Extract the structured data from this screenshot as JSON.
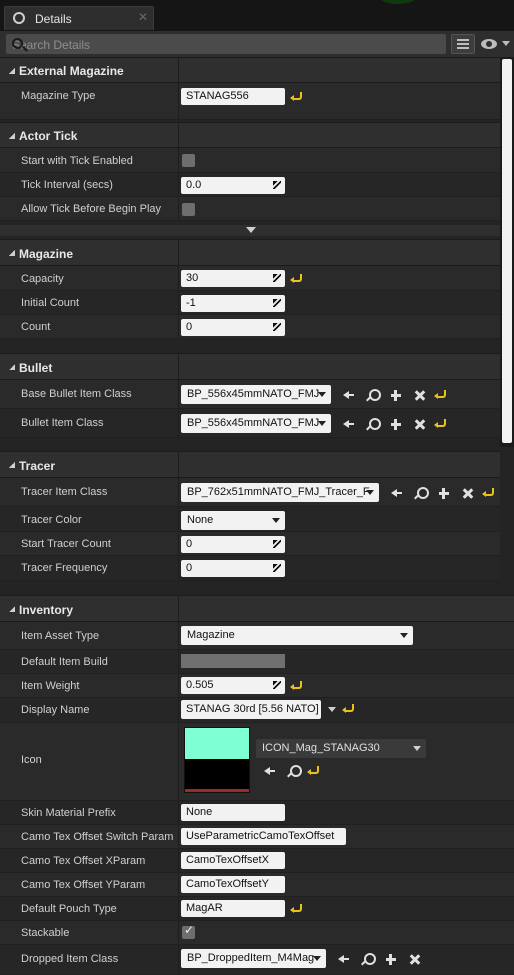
{
  "tab": {
    "label": "Details"
  },
  "search": {
    "placeholder": "Search Details"
  },
  "colors": {
    "reset_arrow": "#e9c21e",
    "icon_preview_top": "#7fffd4",
    "icon_preview_bottom": "#000000",
    "icon_preview_line": "#9c2a2a"
  },
  "categories": {
    "external_magazine": {
      "title": "External Magazine",
      "props": {
        "magazine_type": {
          "label": "Magazine Type",
          "value": "STANAG556"
        }
      }
    },
    "actor_tick": {
      "title": "Actor Tick",
      "props": {
        "start_with_tick": {
          "label": "Start with Tick Enabled",
          "checked": false
        },
        "tick_interval": {
          "label": "Tick Interval (secs)",
          "value": "0.0"
        },
        "allow_tick": {
          "label": "Allow Tick Before Begin Play",
          "checked": false
        }
      }
    },
    "magazine": {
      "title": "Magazine",
      "props": {
        "capacity": {
          "label": "Capacity",
          "value": "30"
        },
        "initial_count": {
          "label": "Initial Count",
          "value": "-1"
        },
        "count": {
          "label": "Count",
          "value": "0"
        }
      }
    },
    "bullet": {
      "title": "Bullet",
      "props": {
        "base_bullet_item_class": {
          "label": "Base Bullet Item Class",
          "value": "BP_556x45mmNATO_FMJ"
        },
        "bullet_item_class": {
          "label": "Bullet Item Class",
          "value": "BP_556x45mmNATO_FMJ"
        }
      }
    },
    "tracer": {
      "title": "Tracer",
      "props": {
        "tracer_item_class": {
          "label": "Tracer Item Class",
          "value": "BP_762x51mmNATO_FMJ_Tracer_F"
        },
        "tracer_color": {
          "label": "Tracer Color",
          "value": "None"
        },
        "start_tracer_count": {
          "label": "Start Tracer Count",
          "value": "0"
        },
        "tracer_frequency": {
          "label": "Tracer Frequency",
          "value": "0"
        }
      }
    },
    "inventory": {
      "title": "Inventory",
      "props": {
        "item_asset_type": {
          "label": "Item Asset Type",
          "value": "Magazine"
        },
        "default_item_build": {
          "label": "Default Item Build"
        },
        "item_weight": {
          "label": "Item Weight",
          "value": "0.505"
        },
        "display_name": {
          "label": "Display Name",
          "value": "STANAG 30rd [5.56 NATO]"
        },
        "icon": {
          "label": "Icon",
          "value": "ICON_Mag_STANAG30"
        },
        "skin_material_prefix": {
          "label": "Skin Material Prefix",
          "value": "None"
        },
        "camo_switch_param": {
          "label": "Camo Tex Offset Switch Param",
          "value": "UseParametricCamoTexOffset"
        },
        "camo_x_param": {
          "label": "Camo Tex Offset XParam",
          "value": "CamoTexOffsetX"
        },
        "camo_y_param": {
          "label": "Camo Tex Offset YParam",
          "value": "CamoTexOffsetY"
        },
        "default_pouch_type": {
          "label": "Default Pouch Type",
          "value": "MagAR"
        },
        "stackable": {
          "label": "Stackable",
          "checked": true
        },
        "dropped_item_class": {
          "label": "Dropped Item Class",
          "value": "BP_DroppedItem_M4Mag"
        }
      }
    }
  }
}
